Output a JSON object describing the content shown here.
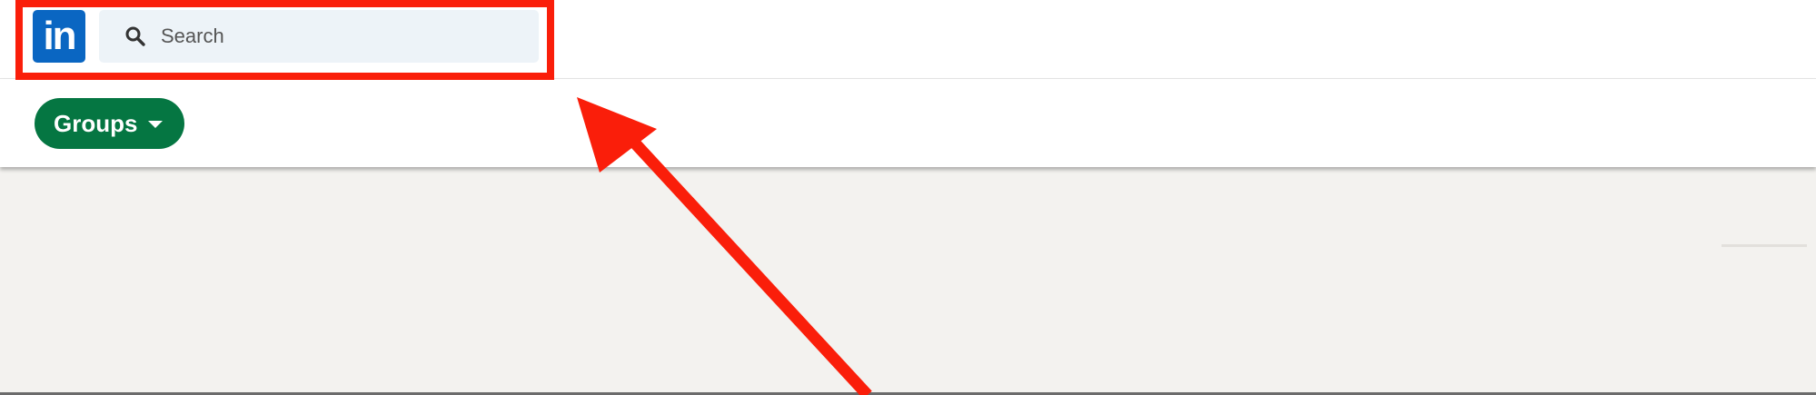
{
  "nav": {
    "logo_text": "in",
    "logo_color": "#0a66c2",
    "search": {
      "placeholder": "Search",
      "icon": "search-icon"
    }
  },
  "subnav": {
    "groups_button": {
      "label": "Groups",
      "color": "#057642",
      "icon": "caret-down-icon"
    }
  },
  "annotations": {
    "highlight_color": "#fa1e0a"
  }
}
